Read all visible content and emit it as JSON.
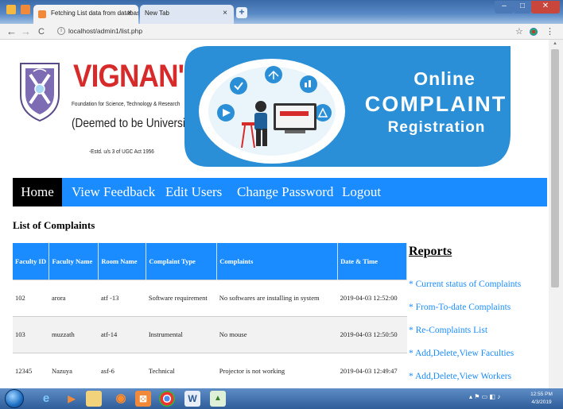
{
  "browser": {
    "tabs": [
      {
        "title": "Fetching List data from database",
        "close": "×",
        "active": true
      },
      {
        "title": "New Tab",
        "close": "×",
        "active": false
      }
    ],
    "new_tab": "+",
    "url": "localhost/admin1/list.php",
    "nav": {
      "back": "←",
      "forward": "→",
      "reload": "C",
      "star": "☆",
      "menu": "⋮"
    }
  },
  "banner": {
    "name": "VIGNAN'S",
    "foundation": "Foundation for Science, Technology & Research",
    "deemed": "(Deemed to be University)",
    "estd": "-Estd. u/s 3 of UGC Act 1956",
    "line1": "Online",
    "line2": "COMPLAINT",
    "line3": "Registration",
    "colors": {
      "brand_red": "#d72b2b",
      "banner_blue": "#2a8fd6"
    }
  },
  "nav": {
    "items": [
      "Home",
      "View Feedback",
      "Edit Users",
      "Change Password",
      "Logout"
    ],
    "active": "Home",
    "color": "#1a8cff"
  },
  "list": {
    "title": "List of Complaints",
    "columns": [
      "Faculty ID",
      "Faculty Name",
      "Room Name",
      "Complaint Type",
      "Complaints",
      "Date & Time"
    ],
    "rows": [
      [
        "102",
        "arora",
        "atf -13",
        "Software requirement",
        "No softwares are installing in system",
        "2019-04-03 12:52:00"
      ],
      [
        "103",
        "muzzath",
        "atf-14",
        "Instrumental",
        "No mouse",
        "2019-04-03 12:50:50"
      ],
      [
        "12345",
        "Nazuya",
        "asf-6",
        "Technical",
        "Projector is not working",
        "2019-04-03 12:49:47"
      ]
    ]
  },
  "reports": {
    "title": "Reports",
    "links": [
      "* Current status of Complaints",
      "* From-To-date Complaints",
      "* Re-Complaints List",
      "* Add,Delete,View Faculties",
      "* Add,Delete,View Workers"
    ]
  },
  "taskbar": {
    "apps": [
      "e",
      "▶",
      "📁",
      "◉",
      "✉",
      "◎",
      "W",
      "▲"
    ],
    "time": "12:55 PM",
    "date": "4/3/2019"
  }
}
